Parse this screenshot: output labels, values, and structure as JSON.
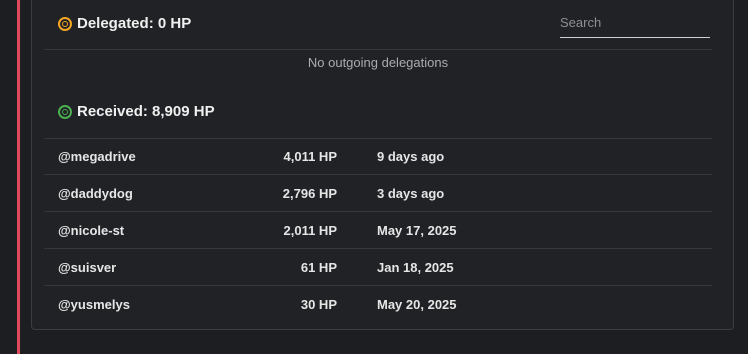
{
  "delegated": {
    "label": "Delegated: 0 HP",
    "empty_message": "No outgoing delegations"
  },
  "search": {
    "placeholder": "Search"
  },
  "received": {
    "label": "Received: 8,909 HP",
    "rows": [
      {
        "user": "@megadrive",
        "amount": "4,011 HP",
        "date": "9 days ago"
      },
      {
        "user": "@daddydog",
        "amount": "2,796 HP",
        "date": "3 days ago"
      },
      {
        "user": "@nicole-st",
        "amount": "2,011 HP",
        "date": "May 17, 2025"
      },
      {
        "user": "@suisver",
        "amount": "61 HP",
        "date": "Jan 18, 2025"
      },
      {
        "user": "@yusmelys",
        "amount": "30 HP",
        "date": "May 20, 2025"
      }
    ]
  },
  "colors": {
    "accent_bar": "#e0495b",
    "delegated_icon": "#f5a623",
    "received_icon": "#4caf50"
  }
}
